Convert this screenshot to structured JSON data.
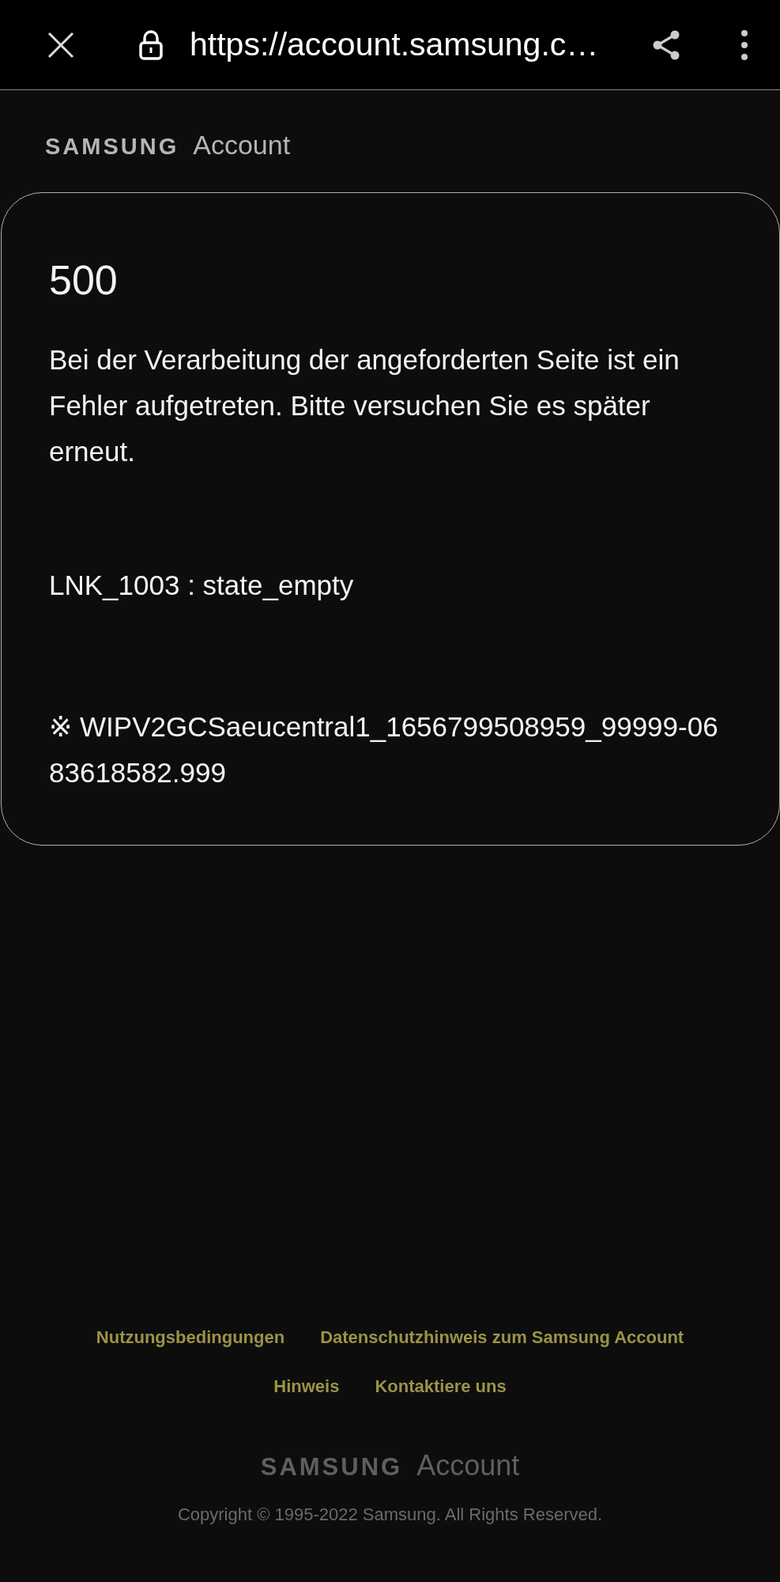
{
  "browser_bar": {
    "url": "https://account.samsung.c…"
  },
  "header_logo": {
    "brand": "SAMSUNG",
    "product": "Account"
  },
  "error_card": {
    "code": "500",
    "message": "Bei der Verarbeitung der angeforderten Seite ist ein Fehler aufgetreten. Bitte versuchen Sie es später erneut.",
    "detail": "LNK_1003 : state_empty",
    "trace": "※ WIPV2GCSaeucentral1_1656799508959_99999-0683618582.999"
  },
  "footer": {
    "links": [
      "Nutzungsbedingungen",
      "Datenschutzhinweis zum Samsung Account",
      "Hinweis",
      "Kontaktiere uns"
    ],
    "logo": {
      "brand": "SAMSUNG",
      "product": "Account"
    },
    "copyright": "Copyright © 1995-2022 Samsung. All Rights Reserved."
  }
}
